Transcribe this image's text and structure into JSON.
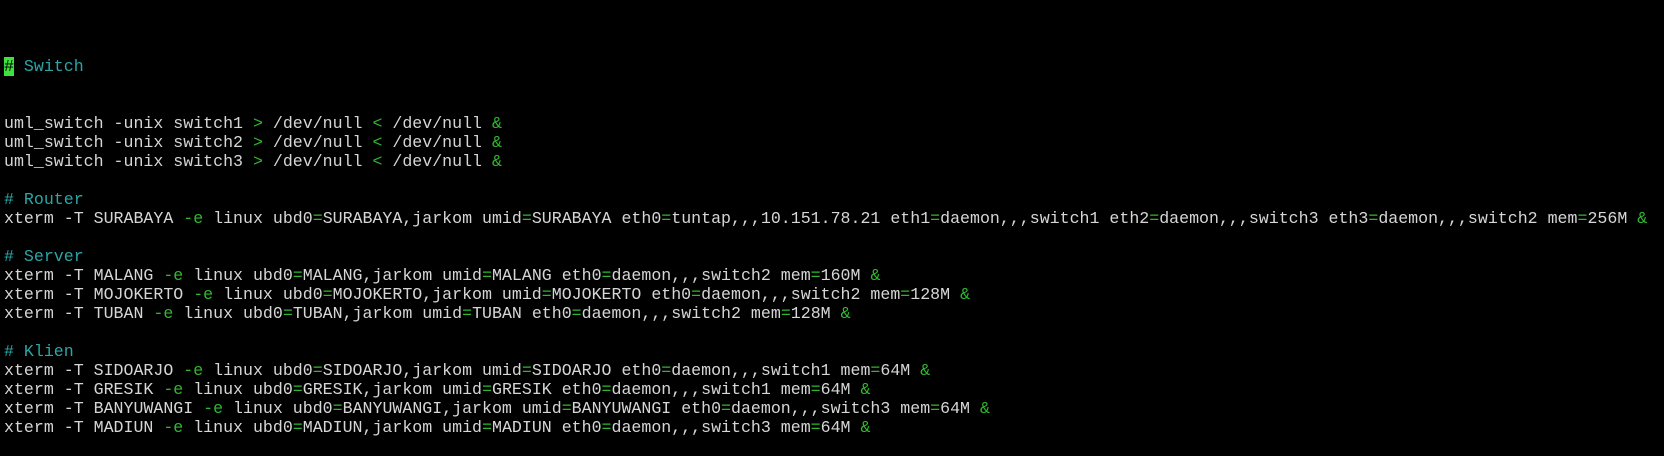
{
  "colors": {
    "background": "#000000",
    "foreground": "#d6d6d6",
    "comment": "#2aa6a6",
    "operator": "#2fb82f",
    "cursor": "#3ee23e"
  },
  "editor": {
    "cursor_char": "#",
    "lines": [
      [
        {
          "t": "c",
          "v": " Switch"
        }
      ],
      [
        {
          "t": "p",
          "v": "uml_switch -unix switch1 "
        },
        {
          "t": "o",
          "v": ">"
        },
        {
          "t": "p",
          "v": " /dev/null "
        },
        {
          "t": "o",
          "v": "<"
        },
        {
          "t": "p",
          "v": " /dev/null "
        },
        {
          "t": "o",
          "v": "&"
        }
      ],
      [
        {
          "t": "p",
          "v": "uml_switch -unix switch2 "
        },
        {
          "t": "o",
          "v": ">"
        },
        {
          "t": "p",
          "v": " /dev/null "
        },
        {
          "t": "o",
          "v": "<"
        },
        {
          "t": "p",
          "v": " /dev/null "
        },
        {
          "t": "o",
          "v": "&"
        }
      ],
      [
        {
          "t": "p",
          "v": "uml_switch -unix switch3 "
        },
        {
          "t": "o",
          "v": ">"
        },
        {
          "t": "p",
          "v": " /dev/null "
        },
        {
          "t": "o",
          "v": "<"
        },
        {
          "t": "p",
          "v": " /dev/null "
        },
        {
          "t": "o",
          "v": "&"
        }
      ],
      [],
      [
        {
          "t": "c",
          "v": "# Router"
        }
      ],
      [
        {
          "t": "p",
          "v": "xterm -T SURABAYA "
        },
        {
          "t": "o",
          "v": "-e"
        },
        {
          "t": "p",
          "v": " linux ubd0"
        },
        {
          "t": "o",
          "v": "="
        },
        {
          "t": "p",
          "v": "SURABAYA,jarkom umid"
        },
        {
          "t": "o",
          "v": "="
        },
        {
          "t": "p",
          "v": "SURABAYA eth0"
        },
        {
          "t": "o",
          "v": "="
        },
        {
          "t": "p",
          "v": "tuntap,,,10.151.78.21 eth1"
        },
        {
          "t": "o",
          "v": "="
        },
        {
          "t": "p",
          "v": "daemon,,,switch1 eth2"
        },
        {
          "t": "o",
          "v": "="
        },
        {
          "t": "p",
          "v": "daemon,,,switch3 eth3"
        },
        {
          "t": "o",
          "v": "="
        },
        {
          "t": "p",
          "v": "daemon,,,switch2 mem"
        },
        {
          "t": "o",
          "v": "="
        },
        {
          "t": "p",
          "v": "256M "
        },
        {
          "t": "o",
          "v": "&"
        }
      ],
      [],
      [
        {
          "t": "c",
          "v": "# Server"
        }
      ],
      [
        {
          "t": "p",
          "v": "xterm -T MALANG "
        },
        {
          "t": "o",
          "v": "-e"
        },
        {
          "t": "p",
          "v": " linux ubd0"
        },
        {
          "t": "o",
          "v": "="
        },
        {
          "t": "p",
          "v": "MALANG,jarkom umid"
        },
        {
          "t": "o",
          "v": "="
        },
        {
          "t": "p",
          "v": "MALANG eth0"
        },
        {
          "t": "o",
          "v": "="
        },
        {
          "t": "p",
          "v": "daemon,,,switch2 mem"
        },
        {
          "t": "o",
          "v": "="
        },
        {
          "t": "p",
          "v": "160M "
        },
        {
          "t": "o",
          "v": "&"
        }
      ],
      [
        {
          "t": "p",
          "v": "xterm -T MOJOKERTO "
        },
        {
          "t": "o",
          "v": "-e"
        },
        {
          "t": "p",
          "v": " linux ubd0"
        },
        {
          "t": "o",
          "v": "="
        },
        {
          "t": "p",
          "v": "MOJOKERTO,jarkom umid"
        },
        {
          "t": "o",
          "v": "="
        },
        {
          "t": "p",
          "v": "MOJOKERTO eth0"
        },
        {
          "t": "o",
          "v": "="
        },
        {
          "t": "p",
          "v": "daemon,,,switch2 mem"
        },
        {
          "t": "o",
          "v": "="
        },
        {
          "t": "p",
          "v": "128M "
        },
        {
          "t": "o",
          "v": "&"
        }
      ],
      [
        {
          "t": "p",
          "v": "xterm -T TUBAN "
        },
        {
          "t": "o",
          "v": "-e"
        },
        {
          "t": "p",
          "v": " linux ubd0"
        },
        {
          "t": "o",
          "v": "="
        },
        {
          "t": "p",
          "v": "TUBAN,jarkom umid"
        },
        {
          "t": "o",
          "v": "="
        },
        {
          "t": "p",
          "v": "TUBAN eth0"
        },
        {
          "t": "o",
          "v": "="
        },
        {
          "t": "p",
          "v": "daemon,,,switch2 mem"
        },
        {
          "t": "o",
          "v": "="
        },
        {
          "t": "p",
          "v": "128M "
        },
        {
          "t": "o",
          "v": "&"
        }
      ],
      [],
      [
        {
          "t": "c",
          "v": "# Klien"
        }
      ],
      [
        {
          "t": "p",
          "v": "xterm -T SIDOARJO "
        },
        {
          "t": "o",
          "v": "-e"
        },
        {
          "t": "p",
          "v": " linux ubd0"
        },
        {
          "t": "o",
          "v": "="
        },
        {
          "t": "p",
          "v": "SIDOARJO,jarkom umid"
        },
        {
          "t": "o",
          "v": "="
        },
        {
          "t": "p",
          "v": "SIDOARJO eth0"
        },
        {
          "t": "o",
          "v": "="
        },
        {
          "t": "p",
          "v": "daemon,,,switch1 mem"
        },
        {
          "t": "o",
          "v": "="
        },
        {
          "t": "p",
          "v": "64M "
        },
        {
          "t": "o",
          "v": "&"
        }
      ],
      [
        {
          "t": "p",
          "v": "xterm -T GRESIK "
        },
        {
          "t": "o",
          "v": "-e"
        },
        {
          "t": "p",
          "v": " linux ubd0"
        },
        {
          "t": "o",
          "v": "="
        },
        {
          "t": "p",
          "v": "GRESIK,jarkom umid"
        },
        {
          "t": "o",
          "v": "="
        },
        {
          "t": "p",
          "v": "GRESIK eth0"
        },
        {
          "t": "o",
          "v": "="
        },
        {
          "t": "p",
          "v": "daemon,,,switch1 mem"
        },
        {
          "t": "o",
          "v": "="
        },
        {
          "t": "p",
          "v": "64M "
        },
        {
          "t": "o",
          "v": "&"
        }
      ],
      [
        {
          "t": "p",
          "v": "xterm -T BANYUWANGI "
        },
        {
          "t": "o",
          "v": "-e"
        },
        {
          "t": "p",
          "v": " linux ubd0"
        },
        {
          "t": "o",
          "v": "="
        },
        {
          "t": "p",
          "v": "BANYUWANGI,jarkom umid"
        },
        {
          "t": "o",
          "v": "="
        },
        {
          "t": "p",
          "v": "BANYUWANGI eth0"
        },
        {
          "t": "o",
          "v": "="
        },
        {
          "t": "p",
          "v": "daemon,,,switch3 mem"
        },
        {
          "t": "o",
          "v": "="
        },
        {
          "t": "p",
          "v": "64M "
        },
        {
          "t": "o",
          "v": "&"
        }
      ],
      [
        {
          "t": "p",
          "v": "xterm -T MADIUN "
        },
        {
          "t": "o",
          "v": "-e"
        },
        {
          "t": "p",
          "v": " linux ubd0"
        },
        {
          "t": "o",
          "v": "="
        },
        {
          "t": "p",
          "v": "MADIUN,jarkom umid"
        },
        {
          "t": "o",
          "v": "="
        },
        {
          "t": "p",
          "v": "MADIUN eth0"
        },
        {
          "t": "o",
          "v": "="
        },
        {
          "t": "p",
          "v": "daemon,,,switch3 mem"
        },
        {
          "t": "o",
          "v": "="
        },
        {
          "t": "p",
          "v": "64M "
        },
        {
          "t": "o",
          "v": "&"
        }
      ]
    ]
  }
}
